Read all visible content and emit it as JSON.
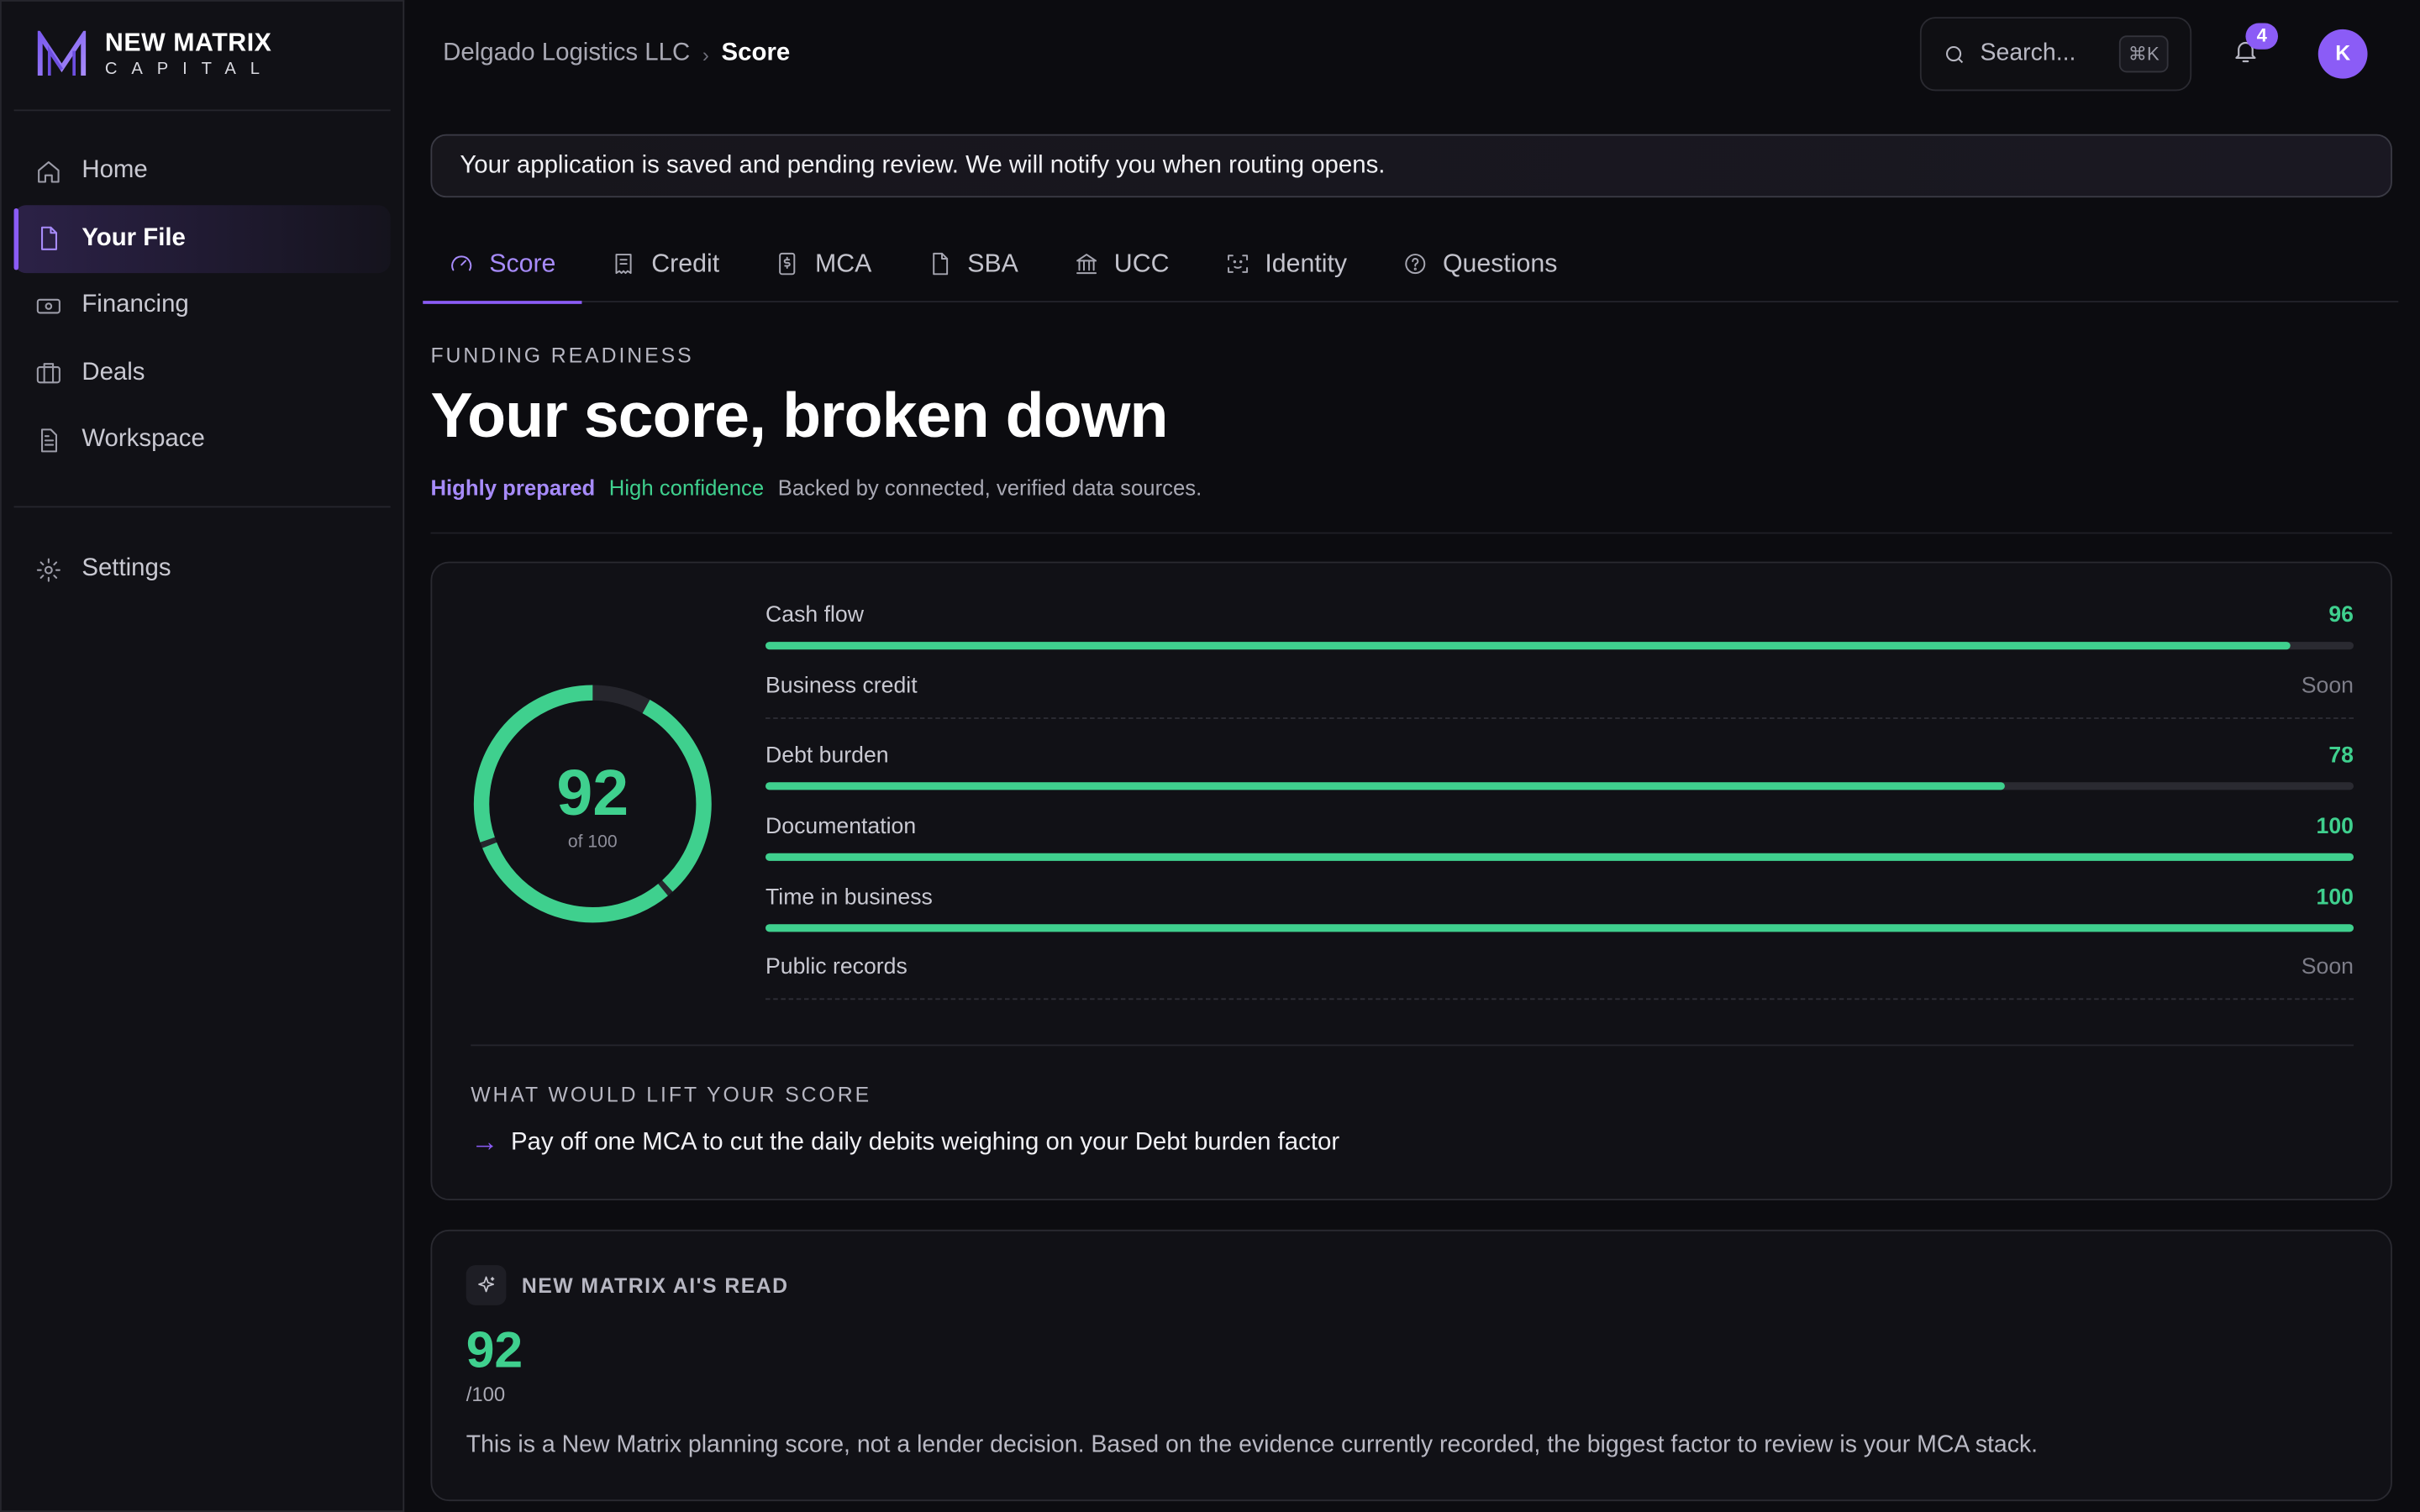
{
  "brand": {
    "name": "NEW MATRIX",
    "sub": "CAPITAL",
    "accent": "#8b5cf6",
    "logo_icon": "n-monogram-logo"
  },
  "sidebar": {
    "items": [
      {
        "label": "Home",
        "icon": "home-icon"
      },
      {
        "label": "Your File",
        "icon": "file-icon",
        "active": true
      },
      {
        "label": "Financing",
        "icon": "banknote-icon"
      },
      {
        "label": "Deals",
        "icon": "briefcase-icon"
      },
      {
        "label": "Workspace",
        "icon": "document-icon"
      }
    ],
    "settings": {
      "label": "Settings",
      "icon": "gear-icon"
    }
  },
  "header": {
    "breadcrumb": {
      "parent": "Delgado Logistics LLC",
      "current": "Score"
    },
    "search": {
      "placeholder": "Search...",
      "shortcut": "⌘K"
    },
    "notifications": {
      "count": "4"
    },
    "avatar": {
      "initial": "K"
    }
  },
  "notice": "Your application is saved and pending review. We will notify you when routing opens.",
  "tabs": [
    {
      "label": "Score",
      "icon": "gauge-icon",
      "active": true
    },
    {
      "label": "Credit",
      "icon": "receipt-icon"
    },
    {
      "label": "MCA",
      "icon": "dollar-doc-icon"
    },
    {
      "label": "SBA",
      "icon": "file-icon"
    },
    {
      "label": "UCC",
      "icon": "bank-icon"
    },
    {
      "label": "Identity",
      "icon": "scan-face-icon"
    },
    {
      "label": "Questions",
      "icon": "help-circle-icon"
    }
  ],
  "page": {
    "eyebrow": "FUNDING READINESS",
    "title": "Your score, broken down",
    "tags": {
      "prepared": "Highly prepared",
      "confidence": "High confidence",
      "note": "Backed by connected, verified data sources."
    }
  },
  "score": {
    "value": "92",
    "of": "of 100",
    "fraction": 0.92,
    "factors": [
      {
        "name": "Cash flow",
        "value": "96",
        "fraction": 0.96
      },
      {
        "name": "Business credit",
        "value": "Soon",
        "fraction": null
      },
      {
        "name": "Debt burden",
        "value": "78",
        "fraction": 0.78
      },
      {
        "name": "Documentation",
        "value": "100",
        "fraction": 1.0
      },
      {
        "name": "Time in business",
        "value": "100",
        "fraction": 1.0
      },
      {
        "name": "Public records",
        "value": "Soon",
        "fraction": null
      }
    ],
    "lift_label": "WHAT WOULD LIFT YOUR SCORE",
    "lift_items": [
      "Pay off one MCA to cut the daily debits weighing on your Debt burden factor"
    ]
  },
  "ai_read": {
    "title": "NEW MATRIX AI'S READ",
    "score": "92",
    "out_of": "/100",
    "text": "This is a New Matrix planning score, not a lender decision. Based on the evidence currently recorded, the biggest factor to review is your MCA stack."
  },
  "colors": {
    "score_green": "#3fd08e",
    "track": "#2a2a31",
    "background": "#0c0c10"
  }
}
